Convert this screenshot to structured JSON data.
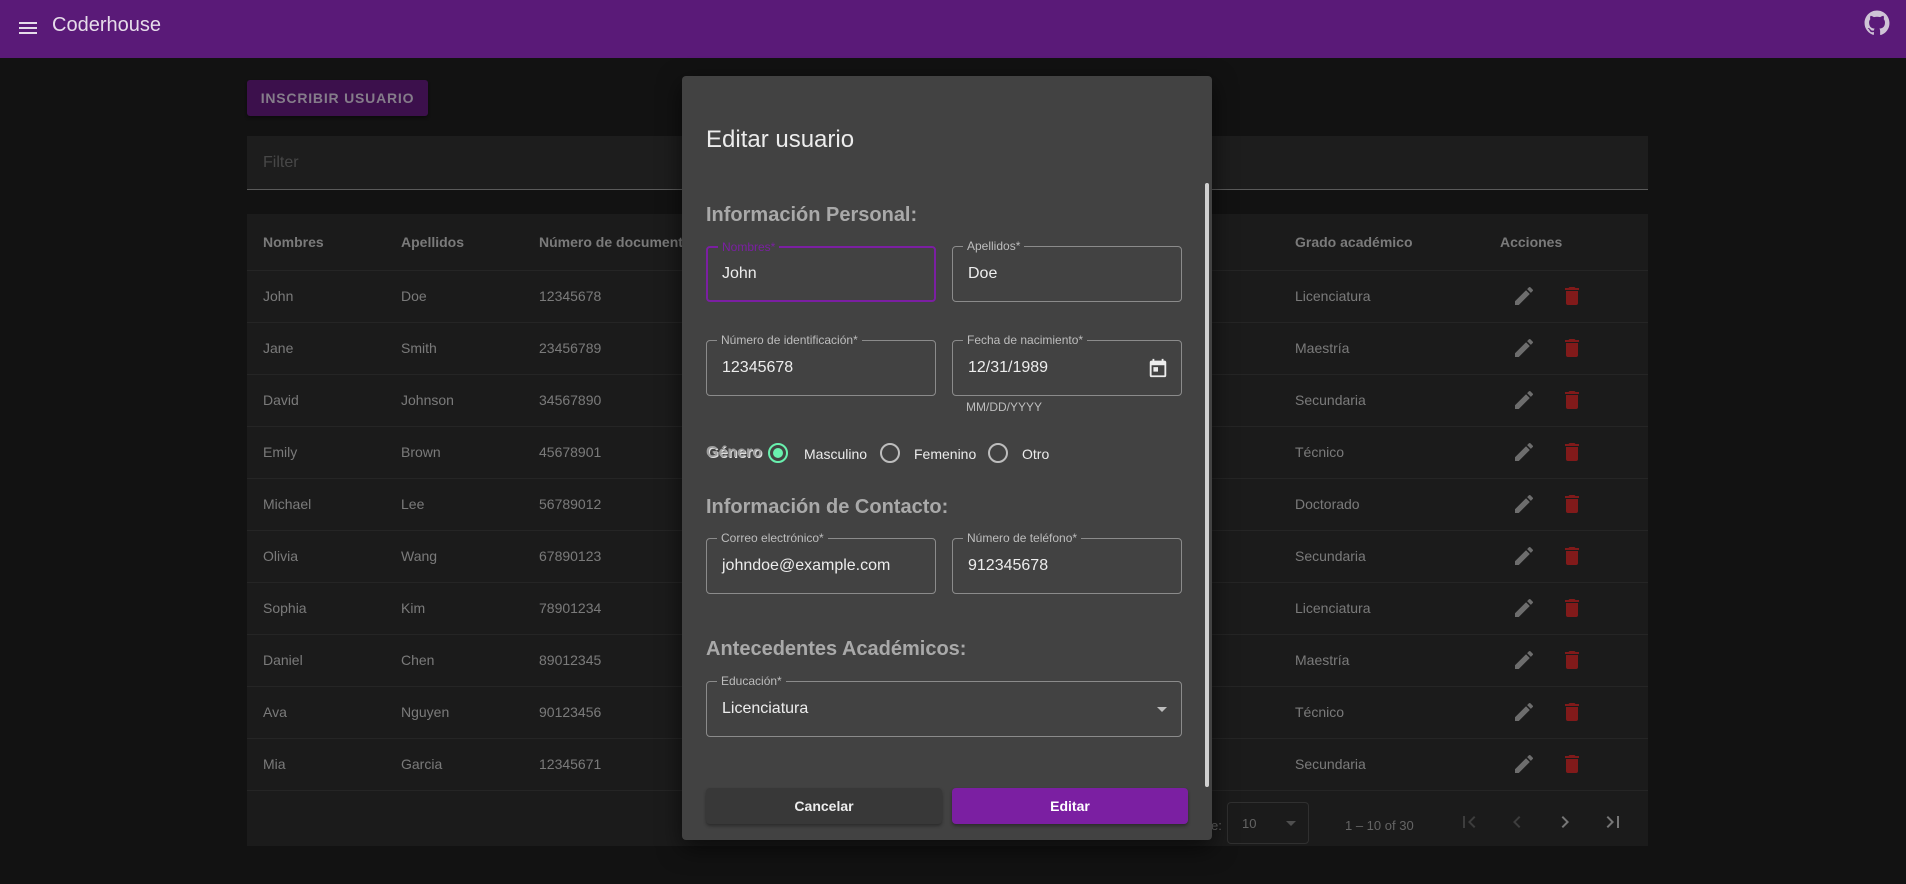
{
  "app": {
    "title": "Coderhouse"
  },
  "page": {
    "enroll_label": "INSCRIBIR USUARIO",
    "filter_placeholder": "Filter"
  },
  "table": {
    "headers": {
      "nombres": "Nombres",
      "apellidos": "Apellidos",
      "documento": "Número de documento",
      "grado": "Grado académico",
      "acciones": "Acciones"
    },
    "rows": [
      {
        "nombre": "John",
        "apellido": "Doe",
        "documento": "12345678",
        "grado": "Licenciatura"
      },
      {
        "nombre": "Jane",
        "apellido": "Smith",
        "documento": "23456789",
        "grado": "Maestría"
      },
      {
        "nombre": "David",
        "apellido": "Johnson",
        "documento": "34567890",
        "grado": "Secundaria"
      },
      {
        "nombre": "Emily",
        "apellido": "Brown",
        "documento": "45678901",
        "grado": "Técnico"
      },
      {
        "nombre": "Michael",
        "apellido": "Lee",
        "documento": "56789012",
        "grado": "Doctorado"
      },
      {
        "nombre": "Olivia",
        "apellido": "Wang",
        "documento": "67890123",
        "grado": "Secundaria"
      },
      {
        "nombre": "Sophia",
        "apellido": "Kim",
        "documento": "78901234",
        "grado": "Licenciatura"
      },
      {
        "nombre": "Daniel",
        "apellido": "Chen",
        "documento": "89012345",
        "grado": "Maestría"
      },
      {
        "nombre": "Ava",
        "apellido": "Nguyen",
        "documento": "90123456",
        "grado": "Técnico"
      },
      {
        "nombre": "Mia",
        "apellido": "Garcia",
        "documento": "12345671",
        "grado": "Secundaria"
      }
    ],
    "paginator": {
      "page_size": "10",
      "range": "1 – 10 of 30",
      "partial_label": "e:"
    }
  },
  "dialog": {
    "title": "Editar usuario",
    "section_personal": "Información Personal:",
    "section_contact": "Información de Contacto:",
    "section_academic": "Antecedentes Académicos:",
    "fields": {
      "nombres": {
        "label": "Nombres*",
        "value": "John"
      },
      "apellidos": {
        "label": "Apellidos*",
        "value": "Doe"
      },
      "identificacion": {
        "label": "Número de identificación*",
        "value": "12345678"
      },
      "nacimiento": {
        "label": "Fecha de nacimiento*",
        "value": "12/31/1989",
        "hint": "MM/DD/YYYY"
      },
      "correo": {
        "label": "Correo electrónico*",
        "value": "johndoe@example.com"
      },
      "telefono": {
        "label": "Número de teléfono*",
        "value": "912345678"
      },
      "educacion": {
        "label": "Educación*",
        "value": "Licenciatura"
      }
    },
    "gender": {
      "label": "Género",
      "options": [
        "Masculino",
        "Femenino",
        "Otro"
      ],
      "selected": "Masculino"
    },
    "cancel_label": "Cancelar",
    "edit_label": "Editar"
  },
  "colors": {
    "toolbar": "#5a1a78",
    "primary": "#7b1fa2",
    "radio_accent": "#69f0ae",
    "delete_icon": "#c62828"
  }
}
